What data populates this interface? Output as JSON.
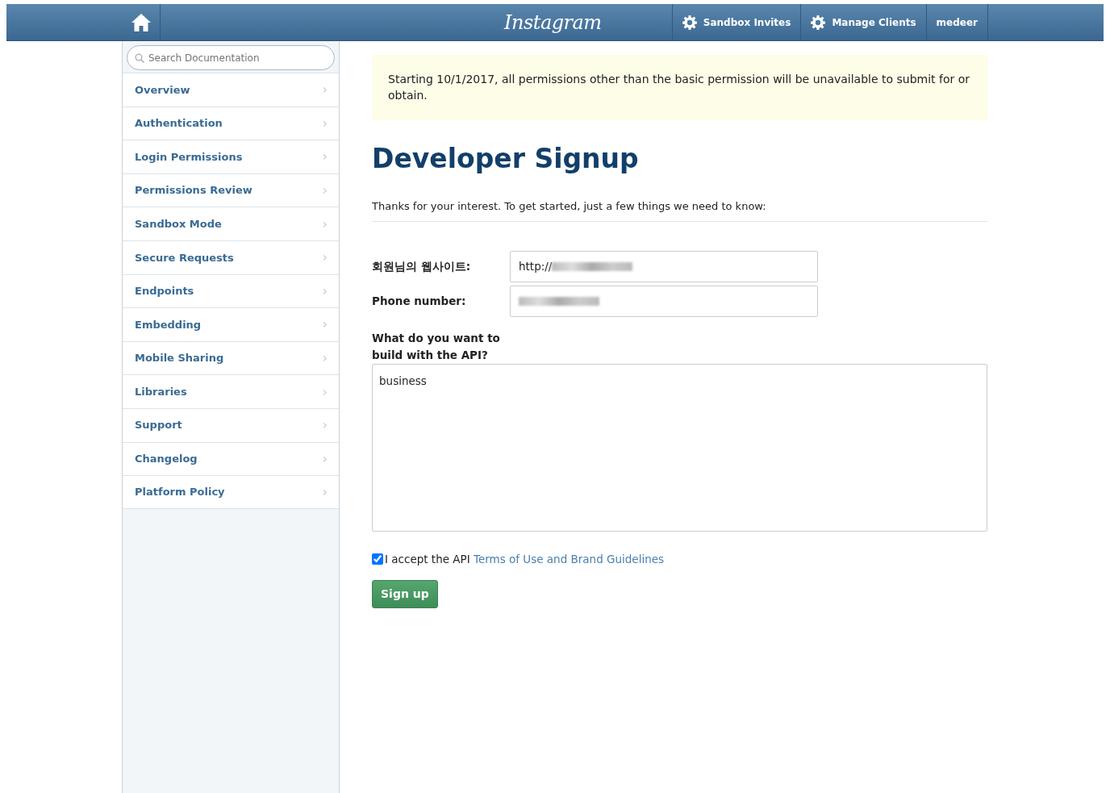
{
  "header": {
    "logo": "Instagram",
    "nav": [
      {
        "label": "Sandbox Invites",
        "kind": "gear"
      },
      {
        "label": "Manage Clients",
        "kind": "gear"
      },
      {
        "label": "medeer",
        "kind": "plain"
      }
    ]
  },
  "sidebar": {
    "search": {
      "placeholder": "Search Documentation"
    },
    "items": [
      {
        "label": "Overview",
        "arrow": "›"
      },
      {
        "label": "Authentication",
        "arrow": "›"
      },
      {
        "label": "Login Permissions",
        "arrow": "›"
      },
      {
        "label": "Permissions Review",
        "arrow": "›"
      },
      {
        "label": "Sandbox Mode",
        "arrow": "›"
      },
      {
        "label": "Secure Requests",
        "arrow": "›"
      },
      {
        "label": "Endpoints",
        "arrow": "›"
      },
      {
        "label": "Embedding",
        "arrow": "›"
      },
      {
        "label": "Mobile Sharing",
        "arrow": "›"
      },
      {
        "label": "Libraries",
        "arrow": "›"
      },
      {
        "label": "Support",
        "arrow": "›"
      },
      {
        "label": "Changelog",
        "arrow": "›"
      },
      {
        "label": "Platform Policy",
        "arrow": "›"
      }
    ]
  },
  "notice": "Starting 10/1/2017, all permissions other than the basic permission will be unavailable to submit for or obtain.",
  "title": "Developer Signup",
  "intro": "Thanks for your interest. To get started, just a few things we need to know:",
  "form": {
    "fields": [
      {
        "label": "회원님의 웹사이트:",
        "value": "http://",
        "redacted": true
      },
      {
        "label": "Phone number:",
        "redacted": true
      }
    ],
    "textarea": {
      "label": "What do you want to build with the API?",
      "value": "business"
    },
    "terms": {
      "checked": true,
      "text": "I accept the API",
      "link": "Terms of Use and Brand Guidelines"
    },
    "submit": "Sign up"
  }
}
